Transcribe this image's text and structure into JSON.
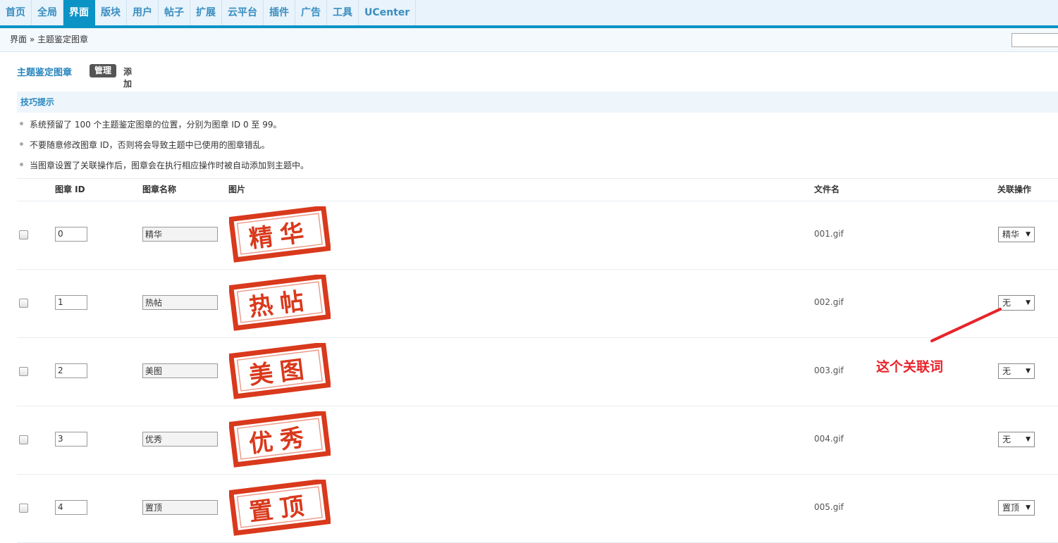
{
  "nav": {
    "tabs": [
      {
        "label": "首页",
        "active": false
      },
      {
        "label": "全局",
        "active": false
      },
      {
        "label": "界面",
        "active": true
      },
      {
        "label": "版块",
        "active": false
      },
      {
        "label": "用户",
        "active": false
      },
      {
        "label": "帖子",
        "active": false
      },
      {
        "label": "扩展",
        "active": false
      },
      {
        "label": "云平台",
        "active": false
      },
      {
        "label": "插件",
        "active": false
      },
      {
        "label": "广告",
        "active": false
      },
      {
        "label": "工具",
        "active": false
      },
      {
        "label": "UCenter",
        "active": false
      }
    ]
  },
  "breadcrumb": "界面 » 主题鉴定图章",
  "search": {
    "value": "",
    "placeholder": ""
  },
  "page": {
    "title": "主题鉴定图章",
    "manage_label": "管理",
    "add_label": "添加"
  },
  "tips": {
    "heading": "技巧提示",
    "items": [
      "系统预留了 100 个主题鉴定图章的位置，分别为图章 ID 0 至 99。",
      "不要随意修改图章 ID，否则将会导致主题中已使用的图章错乱。",
      "当图章设置了关联操作后，图章会在执行相应操作时被自动添加到主题中。"
    ]
  },
  "table": {
    "headers": {
      "id": "图章 ID",
      "name": "图章名称",
      "image": "图片",
      "filename": "文件名",
      "action": "关联操作"
    },
    "rows": [
      {
        "id": "0",
        "name": "精华",
        "stamp": "精华",
        "filename": "001.gif",
        "action": "精华"
      },
      {
        "id": "1",
        "name": "热帖",
        "stamp": "热帖",
        "filename": "002.gif",
        "action": "无"
      },
      {
        "id": "2",
        "name": "美图",
        "stamp": "美图",
        "filename": "003.gif",
        "action": "无"
      },
      {
        "id": "3",
        "name": "优秀",
        "stamp": "优秀",
        "filename": "004.gif",
        "action": "无"
      },
      {
        "id": "4",
        "name": "置顶",
        "stamp": "置顶",
        "filename": "005.gif",
        "action": "置顶"
      }
    ]
  },
  "annotation": {
    "text": "这个关联词",
    "color": "#e8232b"
  },
  "colors": {
    "accent": "#0b93c6",
    "link": "#2a86bd",
    "stamp": "#d9391c"
  }
}
